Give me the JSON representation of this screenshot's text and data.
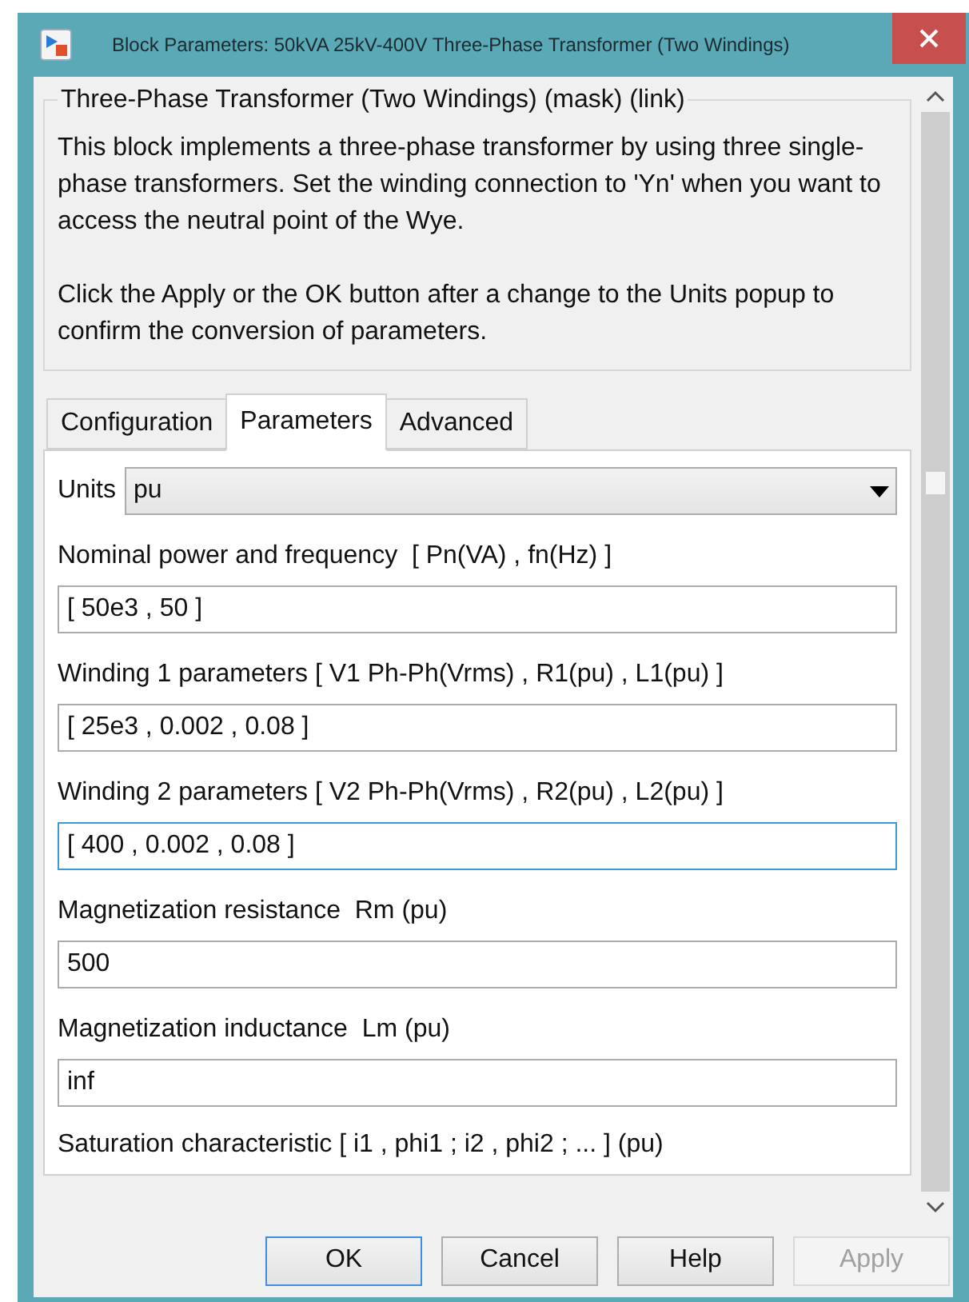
{
  "window": {
    "title": "Block Parameters: 50kVA 25kV-400V Three-Phase Transformer (Two Windings)"
  },
  "mask": {
    "title": "Three-Phase Transformer (Two Windings) (mask) (link)",
    "paragraphs": [
      "This block implements a three-phase transformer by using three single-phase transformers. Set the winding connection to 'Yn' when you want to access the neutral point of the Wye.",
      "Click the Apply or the OK button after a change to the Units popup to confirm the conversion of parameters."
    ]
  },
  "tabs": [
    {
      "label": "Configuration",
      "selected": false
    },
    {
      "label": "Parameters",
      "selected": true
    },
    {
      "label": "Advanced",
      "selected": false
    }
  ],
  "parameters": [
    {
      "kind": "dropdown",
      "label": "Units",
      "value": "pu"
    },
    {
      "kind": "edit",
      "label": "Nominal power and frequency  [ Pn(VA) , fn(Hz) ]",
      "value": "[ 50e3 , 50 ]",
      "focused": false
    },
    {
      "kind": "edit",
      "label": "Winding 1 parameters [ V1 Ph-Ph(Vrms) , R1(pu) , L1(pu) ]",
      "value": "[ 25e3 , 0.002 , 0.08 ]",
      "focused": false
    },
    {
      "kind": "edit",
      "label": "Winding 2 parameters [ V2 Ph-Ph(Vrms) , R2(pu) , L2(pu) ]",
      "value": "[ 400 , 0.002 , 0.08 ]",
      "focused": true
    },
    {
      "kind": "edit",
      "label": "Magnetization resistance  Rm (pu)",
      "value": "500",
      "focused": false
    },
    {
      "kind": "edit",
      "label": "Magnetization inductance  Lm (pu)",
      "value": "inf",
      "focused": false
    },
    {
      "kind": "label",
      "label": "Saturation characteristic [ i1 , phi1 ; i2 , phi2 ; ... ] (pu)"
    }
  ],
  "buttons": [
    {
      "label": "OK",
      "default": true,
      "disabled": false
    },
    {
      "label": "Cancel",
      "default": false,
      "disabled": false
    },
    {
      "label": "Help",
      "default": false,
      "disabled": false
    },
    {
      "label": "Apply",
      "default": false,
      "disabled": true
    }
  ]
}
